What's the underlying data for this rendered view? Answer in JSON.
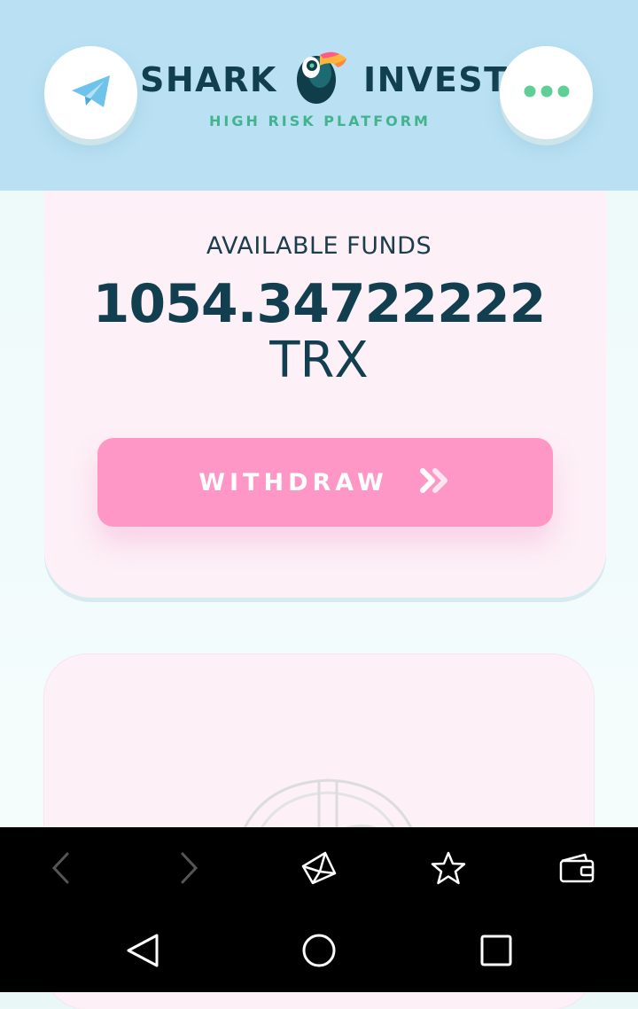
{
  "header": {
    "brand_word_1": "SHARK",
    "brand_word_2": "INVEST",
    "tagline": "HIGH RISK PLATFORM",
    "telegram_icon": "telegram-icon",
    "menu_icon": "more-dots-icon",
    "logo_icon": "toucan-logo",
    "colors": {
      "header_bg": "#b9e0f3",
      "brand_text": "#123f4f",
      "tagline": "#43b38e",
      "dots": "#5fcf96"
    }
  },
  "funds": {
    "label": "AVAILABLE FUNDS",
    "amount": "1054.34722222",
    "currency": "TRX"
  },
  "withdraw": {
    "label": "WITHDRAW",
    "icon": "double-chevron-right-icon",
    "color": "#ff97c6"
  },
  "browser_bar": {
    "icons": [
      "back-arrow-icon",
      "forward-arrow-icon",
      "crystal-icon",
      "star-icon",
      "wallet-icon"
    ]
  },
  "system_nav": {
    "icons": [
      "back-triangle-icon",
      "home-circle-icon",
      "recents-square-icon"
    ]
  }
}
